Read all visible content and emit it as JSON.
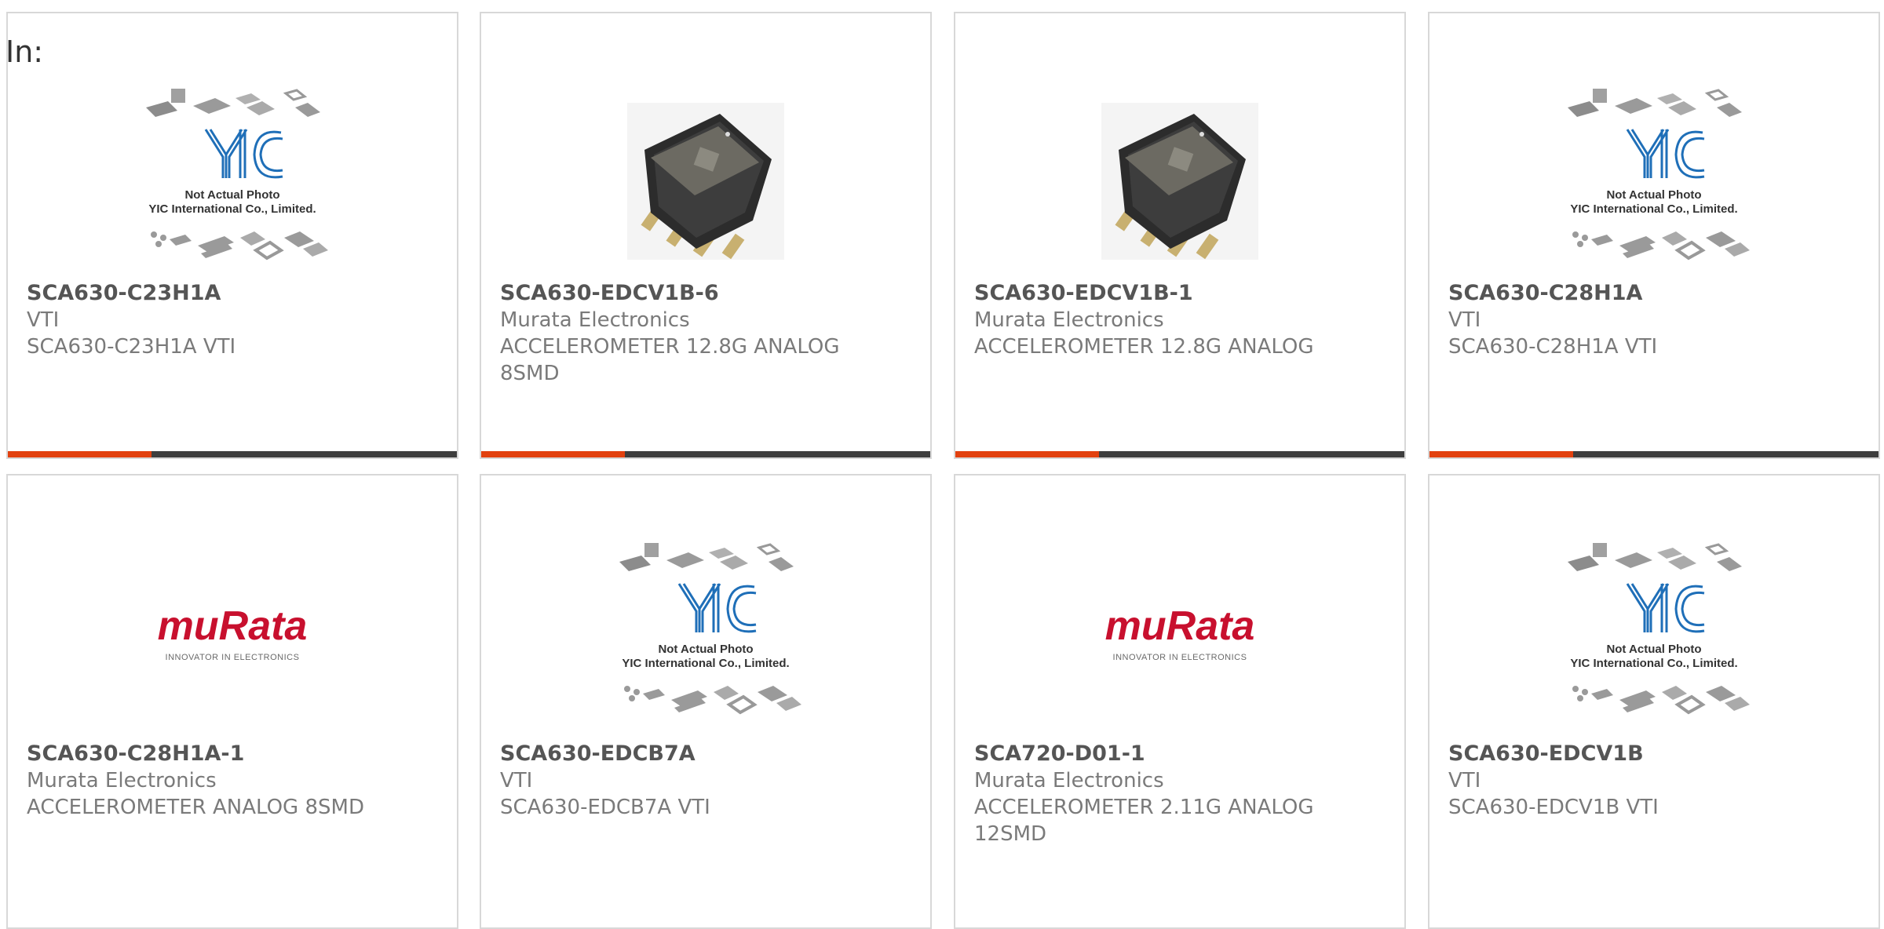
{
  "filter_label": "In:",
  "placeholder": {
    "line1": "Not Actual Photo",
    "line2": "YIC International Co., Limited."
  },
  "murata_logo": {
    "word": "muRata",
    "tagline": "INNOVATOR IN ELECTRONICS"
  },
  "colors": {
    "accent": "#e2410f",
    "bar": "#3e3e3e",
    "murata_red": "#c8102e",
    "yic_blue": "#1f6fb8"
  },
  "products": [
    {
      "part": "SCA630-C23H1A",
      "manufacturer": "VTI",
      "description": "SCA630-C23H1A VTI",
      "image": "yic-placeholder"
    },
    {
      "part": "SCA630-EDCV1B-6",
      "manufacturer": "Murata Electronics",
      "description": "ACCELEROMETER 12.8G ANALOG 8SMD",
      "image": "chip-photo"
    },
    {
      "part": "SCA630-EDCV1B-1",
      "manufacturer": "Murata Electronics",
      "description": "ACCELEROMETER 12.8G ANALOG",
      "image": "chip-photo"
    },
    {
      "part": "SCA630-C28H1A",
      "manufacturer": "VTI",
      "description": "SCA630-C28H1A VTI",
      "image": "yic-placeholder"
    },
    {
      "part": "SCA630-C28H1A-1",
      "manufacturer": "Murata Electronics",
      "description": "ACCELEROMETER ANALOG 8SMD",
      "image": "murata-logo"
    },
    {
      "part": "SCA630-EDCB7A",
      "manufacturer": "VTI",
      "description": "SCA630-EDCB7A VTI",
      "image": "yic-placeholder"
    },
    {
      "part": "SCA720-D01-1",
      "manufacturer": "Murata Electronics",
      "description": "ACCELEROMETER 2.11G ANALOG 12SMD",
      "image": "murata-logo"
    },
    {
      "part": "SCA630-EDCV1B",
      "manufacturer": "VTI",
      "description": "SCA630-EDCV1B VTI",
      "image": "yic-placeholder"
    }
  ]
}
